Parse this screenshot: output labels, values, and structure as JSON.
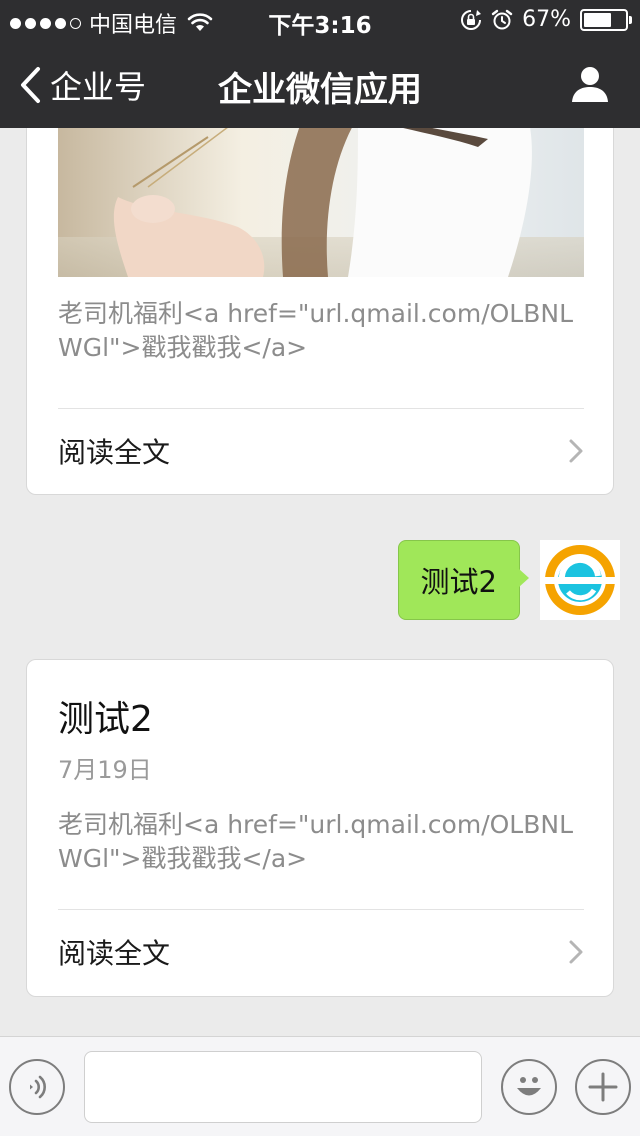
{
  "status_bar": {
    "carrier": "中国电信",
    "time": "下午3:16",
    "battery_percent": "67%",
    "battery_level": 0.67
  },
  "nav": {
    "back_label": "企业号",
    "title": "企业微信应用"
  },
  "messages": {
    "card_1": {
      "summary": "老司机福利<a href=\"url.qmail.com/OLBNLWGl\">戳我戳我</a>",
      "read_more": "阅读全文"
    },
    "sent_bubble": {
      "text": "测试2"
    },
    "card_2": {
      "title": "测试2",
      "date": "7月19日",
      "summary": "老司机福利<a href=\"url.qmail.com/OLBNLWGl\">戳我戳我</a>",
      "read_more": "阅读全文"
    }
  },
  "input_bar": {
    "placeholder": ""
  },
  "colors": {
    "bar_bg": "#2e2e30",
    "chat_bg": "#ebebeb",
    "bubble_green": "#a0e759",
    "avatar_blue": "#1bc3e0",
    "avatar_orange": "#f5a300"
  },
  "icons": [
    "signal-dots-icon",
    "wifi-icon",
    "rotation-lock-icon",
    "alarm-icon",
    "battery-icon",
    "back-chevron-icon",
    "profile-icon",
    "chevron-right-icon",
    "voice-icon",
    "emoji-icon",
    "plus-icon"
  ]
}
